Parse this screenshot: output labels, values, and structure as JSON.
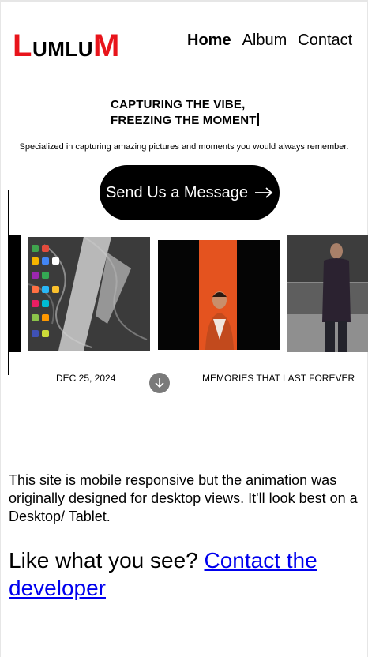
{
  "header": {
    "logo_first": "L",
    "logo_mid": "UMLU",
    "logo_last": "M",
    "nav": [
      {
        "label": "Home"
      },
      {
        "label": "Album"
      },
      {
        "label": "Contact"
      }
    ]
  },
  "hero": {
    "headline_line1": "CAPTURING THE VIBE,",
    "headline_line2": "FREEZING THE MOMENT",
    "subtext": "Specialized in capturing amazing pictures and moments you would always remember.",
    "cta_label": "Send Us a Message",
    "cta_icon": "arrow-right-icon"
  },
  "gallery": {
    "photos": [
      {
        "subject": "phone-screen-photo"
      },
      {
        "subject": "portrait-orange-background-photo"
      },
      {
        "subject": "person-standing-photo"
      }
    ],
    "date": "DEC 25, 2024",
    "scroll_icon": "arrow-down-icon",
    "tagline": "MEMORIES THAT LAST FOREVER"
  },
  "notice": {
    "text": "This site is mobile responsive but the animation was originally designed for desktop views. It'll look best on a Desktop/ Tablet."
  },
  "contact": {
    "prompt": "Like what you see?",
    "link_label": "Contact the developer"
  },
  "colors": {
    "brand_red": "#e8141b",
    "link_blue": "#0000ee",
    "cta_bg": "#000000"
  }
}
